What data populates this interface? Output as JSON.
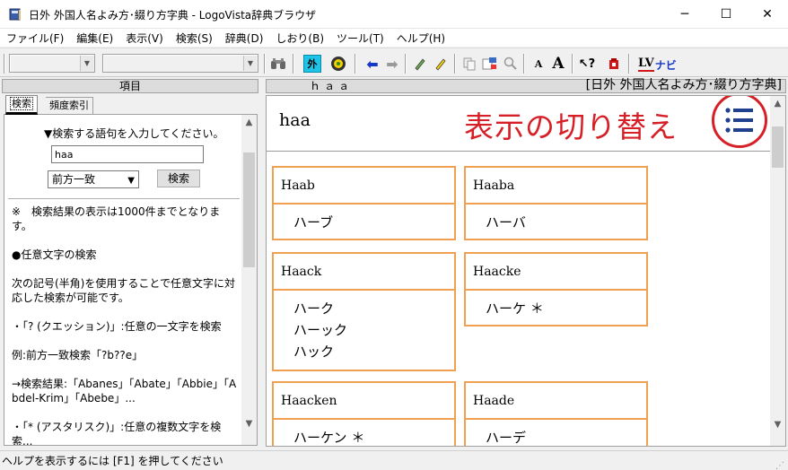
{
  "window": {
    "title": "日外 外国人名よみ方･綴り方字典 - LogoVista辞典ブラウザ",
    "minimize": "─",
    "maximize": "☐",
    "close": "✕"
  },
  "menu": [
    "ファイル(F)",
    "編集(E)",
    "表示(V)",
    "検索(S)",
    "辞典(D)",
    "しおり(B)",
    "ツール(T)",
    "ヘルプ(H)"
  ],
  "toolbar": {
    "foreign_label": "外",
    "font_small": "A",
    "font_large": "A",
    "lv_label": "LV",
    "navi_label": "ナビ"
  },
  "left": {
    "header": "項目",
    "tabs": [
      "検索",
      "頻度索引"
    ],
    "prompt": "▼検索する語句を入力してください。",
    "search_value": "haa",
    "mode": "前方一致",
    "search_button": "検索",
    "help_text": "※　検索結果の表示は1000件までとなります。\n\n●任意文字の検索\n\n次の記号(半角)を使用することで任意文字に対応した検索が可能です。\n\n・「? (クエッション)」:任意の一文字を検索\n\n例:前方一致検索「?b??e」\n\n→検索結果:「Abanes」「Abate」「Abbie」「Abdel-Krim」「Abebe」...\n\n・「* (アスタリスク)」:任意の複数文字を検索..."
  },
  "right": {
    "header_word": "ｈａａ",
    "header_dict": "[日外 外国人名よみ方･綴り方字典]",
    "headword": "haa",
    "annotation": "表示の切り替え",
    "entries": [
      {
        "name": "Haab",
        "readings": [
          "ハーブ"
        ]
      },
      {
        "name": "Haaba",
        "readings": [
          "ハーバ"
        ]
      },
      {
        "name": "Haack",
        "readings": [
          "ハーク",
          "ハーック",
          "ハック"
        ]
      },
      {
        "name": "Haacke",
        "readings": [
          "ハーケ ＊"
        ]
      },
      {
        "name": "Haacken",
        "readings": [
          "ハーケン ＊"
        ]
      },
      {
        "name": "Haade",
        "readings": [
          "ハーデ"
        ]
      }
    ]
  },
  "status": "ヘルプを表示するには [F1] を押してください",
  "colors": {
    "annotation": "#d61f26",
    "card_border": "#f0a050",
    "icon_blue": "#1f3f8f"
  }
}
